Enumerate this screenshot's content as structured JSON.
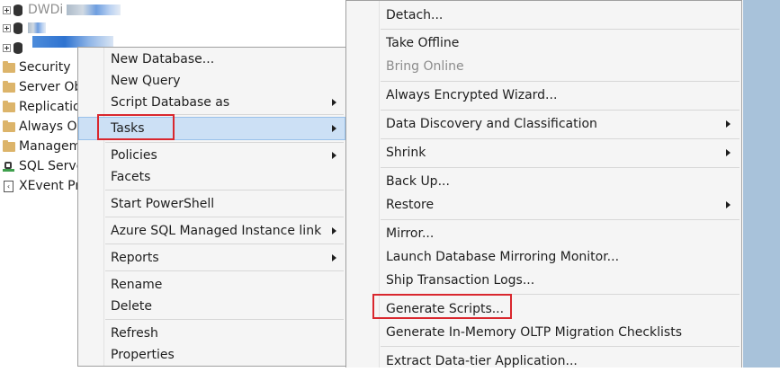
{
  "tree": {
    "items": [
      {
        "label": "Security"
      },
      {
        "label": "Server Obj"
      },
      {
        "label": "Replicatio"
      },
      {
        "label": "Always On"
      },
      {
        "label": "Managem"
      },
      {
        "label": "SQL Serve"
      },
      {
        "label": "XEvent Pro"
      }
    ],
    "partial_label": "DWDi"
  },
  "context_menu": {
    "items": [
      {
        "label": "New Database..."
      },
      {
        "label": "New Query"
      },
      {
        "label": "Script Database as"
      },
      {
        "label": "Tasks"
      },
      {
        "label": "Policies"
      },
      {
        "label": "Facets"
      },
      {
        "label": "Start PowerShell"
      },
      {
        "label": "Azure SQL Managed Instance link"
      },
      {
        "label": "Reports"
      },
      {
        "label": "Rename"
      },
      {
        "label": "Delete"
      },
      {
        "label": "Refresh"
      },
      {
        "label": "Properties"
      }
    ]
  },
  "tasks_menu": {
    "items": [
      {
        "label": "Detach..."
      },
      {
        "label": "Take Offline"
      },
      {
        "label": "Bring Online"
      },
      {
        "label": "Always Encrypted Wizard..."
      },
      {
        "label": "Data Discovery and Classification"
      },
      {
        "label": "Shrink"
      },
      {
        "label": "Back Up..."
      },
      {
        "label": "Restore"
      },
      {
        "label": "Mirror..."
      },
      {
        "label": "Launch Database Mirroring Monitor..."
      },
      {
        "label": "Ship Transaction Logs..."
      },
      {
        "label": "Generate Scripts..."
      },
      {
        "label": "Generate In-Memory OLTP Migration Checklists"
      },
      {
        "label": "Extract Data-tier Application..."
      }
    ]
  },
  "colors": {
    "highlight": "#cce0f5",
    "annotation_red": "#d9272e",
    "side_strip": "#a8c2da"
  }
}
